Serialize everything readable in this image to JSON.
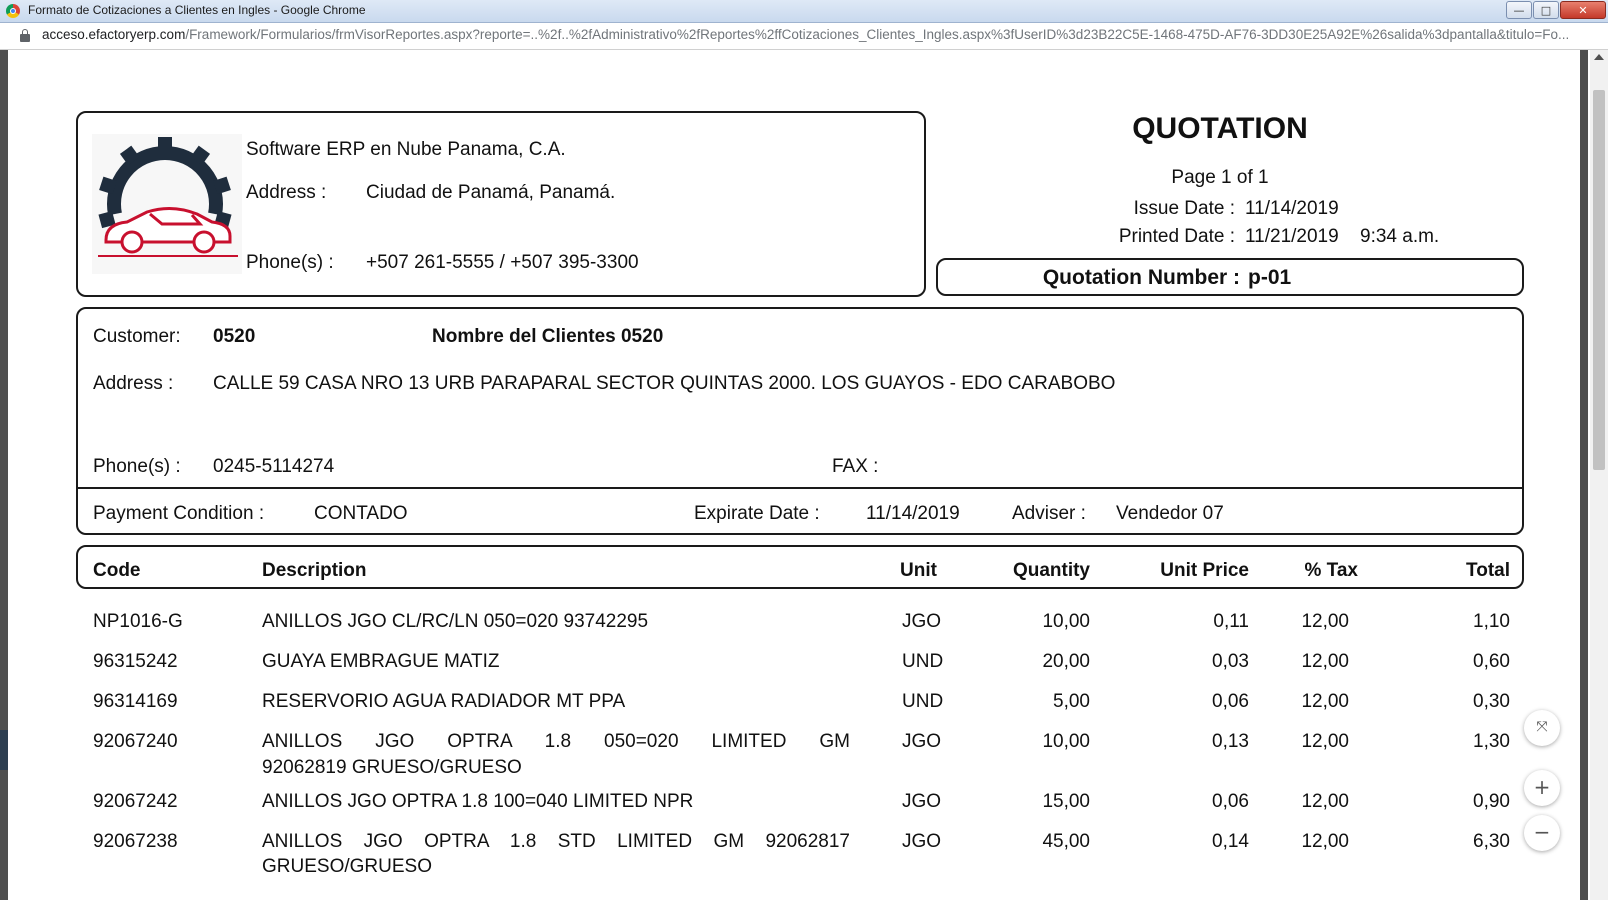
{
  "window": {
    "title": "Formato de Cotizaciones a Clientes en Ingles - Google Chrome",
    "url_domain": "acceso.efactoryerp.com",
    "url_path": "/Framework/Formularios/frmVisorReportes.aspx?reporte=..%2f..%2fAdministrativo%2fReportes%2ffCotizaciones_Clientes_Ingles.aspx%3fUserID%3d23B22C5E-1468-475D-AF76-3DD30E25A92E%26salida%3dpantalla&titulo=Fo..."
  },
  "company": {
    "name": "Software ERP en Nube Panama, C.A.",
    "address_label": "Address :",
    "address": "Ciudad de Panamá, Panamá.",
    "phones_label": "Phone(s) :",
    "phones": "+507 261-5555 / +507 395-3300"
  },
  "header": {
    "title": "QUOTATION",
    "page": "Page 1 of 1",
    "issue_label": "Issue Date :",
    "issue_date": "11/14/2019",
    "printed_label": "Printed Date :",
    "printed_date": "11/21/2019",
    "printed_time": "9:34 a.m.",
    "quotation_label": "Quotation Number :",
    "quotation_number": "p-01"
  },
  "customer": {
    "label": "Customer:",
    "code": "0520",
    "name": "Nombre del Clientes 0520",
    "address_label": "Address :",
    "address": "CALLE 59 CASA NRO 13 URB PARAPARAL SECTOR QUINTAS 2000. LOS GUAYOS - EDO CARABOBO",
    "phones_label": "Phone(s) :",
    "phones": "0245-5114274",
    "fax_label": "FAX :",
    "fax": ""
  },
  "terms": {
    "payment_label": "Payment Condition :",
    "payment": "CONTADO",
    "expiration_label": "Expirate Date :",
    "expiration": "11/14/2019",
    "adviser_label": "Adviser :",
    "adviser": "Vendedor 07"
  },
  "table": {
    "headers": {
      "code": "Code",
      "description": "Description",
      "unit": "Unit",
      "quantity": "Quantity",
      "unit_price": "Unit Price",
      "tax": "% Tax",
      "total": "Total"
    },
    "rows": [
      {
        "code": "NP1016-G",
        "desc1": "ANILLOS JGO CL/RC/LN 050=020 93742295",
        "desc2": "",
        "unit": "JGO",
        "qty": "10,00",
        "price": "0,11",
        "tax": "12,00",
        "total": "1,10"
      },
      {
        "code": "96315242",
        "desc1": "GUAYA EMBRAGUE MATIZ",
        "desc2": "",
        "unit": "UND",
        "qty": "20,00",
        "price": "0,03",
        "tax": "12,00",
        "total": "0,60"
      },
      {
        "code": "96314169",
        "desc1": "RESERVORIO AGUA RADIADOR MT PPA",
        "desc2": "",
        "unit": "UND",
        "qty": "5,00",
        "price": "0,06",
        "tax": "12,00",
        "total": "0,30"
      },
      {
        "code": "92067240",
        "desc1": "ANILLOS JGO OPTRA 1.8 050=020 LIMITED GM",
        "desc2": "92062819 GRUESO/GRUESO",
        "unit": "JGO",
        "qty": "10,00",
        "price": "0,13",
        "tax": "12,00",
        "total": "1,30"
      },
      {
        "code": "92067242",
        "desc1": "ANILLOS JGO OPTRA 1.8 100=040 LIMITED NPR",
        "desc2": "",
        "unit": "JGO",
        "qty": "15,00",
        "price": "0,06",
        "tax": "12,00",
        "total": "0,90"
      },
      {
        "code": "92067238",
        "desc1": "ANILLOS JGO OPTRA 1.8 STD LIMITED GM 92062817",
        "desc2": "GRUESO/GRUESO",
        "unit": "JGO",
        "qty": "45,00",
        "price": "0,14",
        "tax": "12,00",
        "total": "6,30"
      }
    ]
  },
  "controls": {
    "fit_icon": "⤧",
    "zoom_in": "+",
    "zoom_out": "−"
  },
  "colors": {
    "logo_gear": "#1f2d3d",
    "logo_car": "#c8102e"
  }
}
